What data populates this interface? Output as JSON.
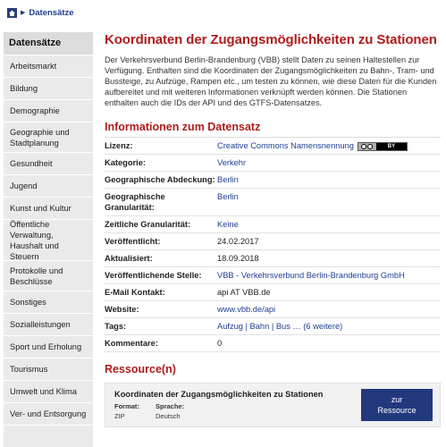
{
  "breadcrumb": {
    "link": "Datensätze",
    "arrow": "▶"
  },
  "sidebar": {
    "title": "Datensätze",
    "items": [
      {
        "label": "Arbeitsmarkt",
        "h": 1
      },
      {
        "label": "Bildung",
        "h": 1
      },
      {
        "label": "Demographie",
        "h": 1
      },
      {
        "label": "Geographie und Stadtplanung",
        "h": 2
      },
      {
        "label": "Gesundheit",
        "h": 1
      },
      {
        "label": "Jugend",
        "h": 1
      },
      {
        "label": "Kunst und Kultur",
        "h": 1
      },
      {
        "label": "Öffentliche Verwaltung, Haushalt und Steuern",
        "h": 3
      },
      {
        "label": "Protokolle und Beschlüsse",
        "h": 2
      },
      {
        "label": "Sonstiges",
        "h": 1
      },
      {
        "label": "Sozialleistungen",
        "h": 1
      },
      {
        "label": "Sport und Erholung",
        "h": 1
      },
      {
        "label": "Tourismus",
        "h": 1
      },
      {
        "label": "Umwelt und Klima",
        "h": 1
      },
      {
        "label": "Ver- und Entsorgung",
        "h": 1
      }
    ]
  },
  "main": {
    "title": "Koordinaten der Zugangsmöglichkeiten zu Stationen",
    "description": "Der Verkehrsverbund Berlin-Brandenburg (VBB) stellt Daten zu seinen Haltestellen zur Verfügung. Enthalten sind die Koordinaten der Zugangsmöglichkeiten zu Bahn-, Tram- und Bussteige, zu Aufzüge, Rampen etc., um testen zu können, wie diese Daten für die Kunden aufbereitet und mit weiteren Informationen verknüpft werden können. Die Stationen enthalten auch die IDs der API und des GTFS-Datensatzes."
  },
  "info": {
    "title": "Informationen zum Datensatz",
    "rows": [
      {
        "key": "Lizenz:",
        "value": "Creative Commons Namensnennung",
        "link": true,
        "badge": true
      },
      {
        "key": "Kategorie:",
        "value": "Verkehr",
        "link": true
      },
      {
        "key": "Geographische Abdeckung:",
        "value": "Berlin",
        "link": true
      },
      {
        "key": "Geographische Granularität:",
        "value": "Berlin",
        "link": true
      },
      {
        "key": "Zeitliche Granularität:",
        "value": "Keine",
        "link": true
      },
      {
        "key": "Veröffentlicht:",
        "value": "24.02.2017",
        "link": false
      },
      {
        "key": "Aktualisiert:",
        "value": "18.09.2018",
        "link": false
      },
      {
        "key": "Veröffentlichende Stelle:",
        "value": "VBB - Verkehrsverbund Berlin-Brandenburg GmbH",
        "link": true
      },
      {
        "key": "E-Mail Kontakt:",
        "value": "api AT VBB.de",
        "link": false
      },
      {
        "key": "Website:",
        "value": "www.vbb.de/api",
        "link": true
      },
      {
        "key": "Tags:",
        "value": "Aufzug | Bahn | Bus … (6 weitere)",
        "link": true
      },
      {
        "key": "Kommentare:",
        "value": "0",
        "link": false
      }
    ],
    "badge_text": "BY"
  },
  "resources": {
    "title": "Ressource(n)",
    "item": {
      "title": "Koordinaten der Zugangsmöglichkeiten zu Stationen",
      "format_label": "Format:",
      "format_value": "ZIP",
      "language_label": "Sprache:",
      "language_value": "Deutsch",
      "button_line1": "zur",
      "button_line2": "Ressource"
    }
  },
  "colors": {
    "accent": "#b01c1c",
    "link": "#1f3f8f",
    "button": "#23397e",
    "sidebar": "#eaeaea"
  }
}
